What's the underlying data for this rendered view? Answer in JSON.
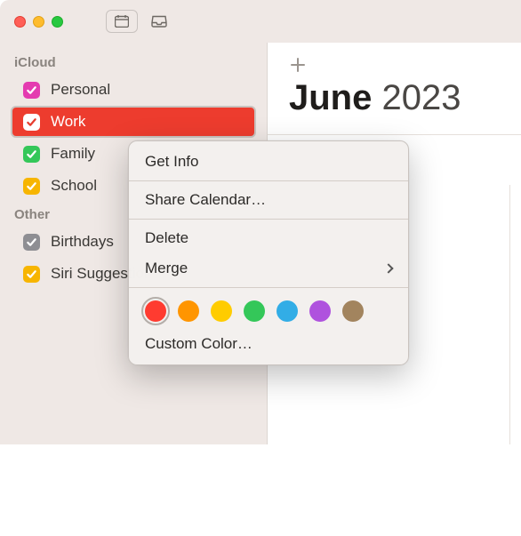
{
  "titlebar": {},
  "sidebar": {
    "sections": [
      {
        "header": "iCloud",
        "items": [
          {
            "label": "Personal",
            "color": "#e43bb0",
            "selected": false
          },
          {
            "label": "Work",
            "color": "#ffffff",
            "box": "#ffffff",
            "check": "#e63c2e",
            "selected": true
          },
          {
            "label": "Family",
            "color": "#34c759",
            "selected": false
          },
          {
            "label": "School",
            "color": "#f7b500",
            "selected": false
          }
        ]
      },
      {
        "header": "Other",
        "items": [
          {
            "label": "Birthdays",
            "color": "#8e8e93",
            "selected": false
          },
          {
            "label": "Siri Suggestions",
            "color": "#f7b500",
            "selected": false
          }
        ]
      }
    ]
  },
  "content": {
    "month": "June",
    "year": "2023"
  },
  "context_menu": {
    "get_info": "Get Info",
    "share": "Share Calendar…",
    "delete": "Delete",
    "merge": "Merge",
    "colors": [
      {
        "hex": "#ff3b30",
        "selected": true
      },
      {
        "hex": "#ff9500",
        "selected": false
      },
      {
        "hex": "#ffcc00",
        "selected": false
      },
      {
        "hex": "#34c759",
        "selected": false
      },
      {
        "hex": "#32ade6",
        "selected": false
      },
      {
        "hex": "#af52de",
        "selected": false
      },
      {
        "hex": "#a2845e",
        "selected": false
      }
    ],
    "custom_color": "Custom Color…"
  }
}
